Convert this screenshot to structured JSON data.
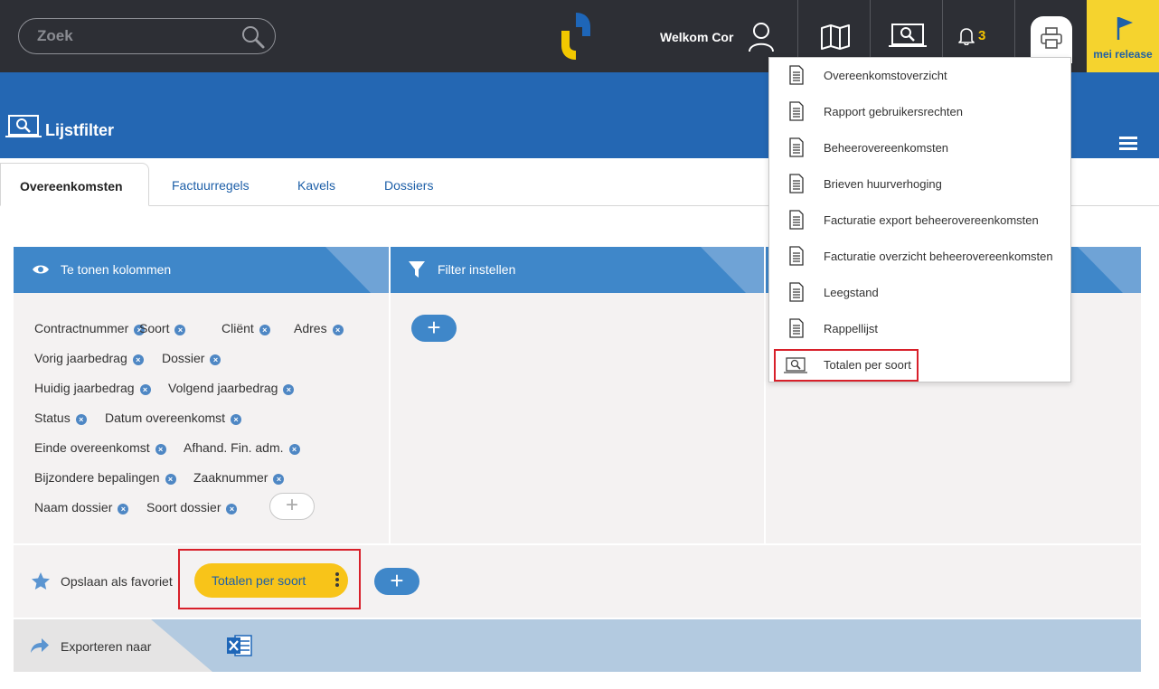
{
  "search": {
    "placeholder": "Zoek"
  },
  "header": {
    "welcome": "Welkom Cor",
    "notification_count": "3",
    "release_label": "mei release"
  },
  "page": {
    "title": "Lijstfilter"
  },
  "tabs": [
    {
      "label": "Overeenkomsten",
      "active": true
    },
    {
      "label": "Factuurregels",
      "active": false
    },
    {
      "label": "Kavels",
      "active": false
    },
    {
      "label": "Dossiers",
      "active": false
    }
  ],
  "panels": {
    "columns": {
      "title": "Te tonen kolommen"
    },
    "filter": {
      "title": "Filter instellen"
    }
  },
  "column_tags": [
    [
      "Contractnummer",
      "Soort",
      "Cliënt",
      "Adres"
    ],
    [
      "Vorig jaarbedrag",
      "Dossier"
    ],
    [
      "Huidig jaarbedrag",
      "Volgend jaarbedrag"
    ],
    [
      "Status",
      "Datum overeenkomst"
    ],
    [
      "Einde overeenkomst",
      "Afhand. Fin. adm."
    ],
    [
      "Bijzondere bepalingen",
      "Zaaknummer"
    ],
    [
      "Naam dossier",
      "Soort dossier"
    ]
  ],
  "favorites": {
    "label": "Opslaan als favoriet",
    "saved": "Totalen per soort"
  },
  "export": {
    "label": "Exporteren naar",
    "format_icon": "excel-icon"
  },
  "print_menu": [
    {
      "label": "Overeenkomstoverzicht",
      "icon": "document-icon"
    },
    {
      "label": "Rapport gebruikersrechten",
      "icon": "document-icon"
    },
    {
      "label": "Beheerovereenkomsten",
      "icon": "document-icon"
    },
    {
      "label": "Brieven huurverhoging",
      "icon": "document-icon"
    },
    {
      "label": "Facturatie export beheerovereenkomsten",
      "icon": "document-icon"
    },
    {
      "label": "Facturatie overzicht beheerovereenkomsten",
      "icon": "document-icon"
    },
    {
      "label": "Leegstand",
      "icon": "document-icon"
    },
    {
      "label": "Rappellijst",
      "icon": "document-icon"
    },
    {
      "label": "Totalen per soort",
      "icon": "list-filter-icon",
      "highlighted": true
    }
  ],
  "colors": {
    "topbar": "#2d2f35",
    "brand_blue": "#2467b3",
    "panel_blue": "#3f87c9",
    "accent_yellow": "#f8c419",
    "highlight_red": "#d8202a"
  }
}
